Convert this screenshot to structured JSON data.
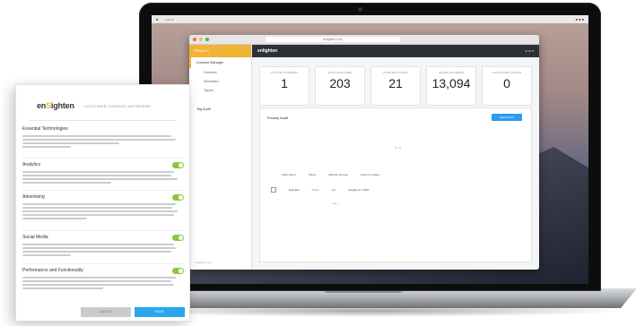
{
  "consent_dialog": {
    "logo_prefix": "en",
    "logo_accent": "S",
    "logo_suffix": "ighten",
    "tagline": "CUSTOMER CONSENT ANYWHERE",
    "sections": [
      {
        "title": "Essential Technologies",
        "toggle": false
      },
      {
        "title": "Analytics",
        "toggle": true
      },
      {
        "title": "Advertising",
        "toggle": true
      },
      {
        "title": "Social Media",
        "toggle": true
      },
      {
        "title": "Performance and Functionality",
        "toggle": true
      }
    ],
    "cancel_label": "CANCEL",
    "save_label": "SAVE",
    "colors": {
      "toggle_on": "#8cc63f",
      "save": "#2aa7ee",
      "brand_accent": "#f1b334"
    }
  },
  "laptop": {
    "url": "enlighten.com",
    "app_title": "enlighten",
    "sidebar": {
      "header": "PRIVACY",
      "items": [
        {
          "label": "Consent Manager"
        },
        {
          "label": "Overview",
          "sub": true
        },
        {
          "label": "Scheduled",
          "sub": true
        },
        {
          "label": "Tag list",
          "sub": true
        },
        {
          "label": "Tag Audit"
        }
      ],
      "footer": "enlighten.com"
    },
    "stat_cards": [
      {
        "label": "VISITOR CONSENT",
        "value": "1"
      },
      {
        "label": "DATA ANALYZED",
        "value": "203"
      },
      {
        "label": "COOKIES FOUND",
        "value": "21"
      },
      {
        "label": "PAGES SCANNED",
        "value": "13,094"
      },
      {
        "label": "VIOLATIONS FOUND",
        "value": "0"
      }
    ],
    "panel": {
      "title": "Privacy Audit",
      "button_label": "NEW AUDIT",
      "columns": [
        "Audit Name",
        "Status",
        "Website Domain",
        "Date & Created"
      ],
      "row": {
        "name": "Example",
        "status": "Active",
        "domain": "enl",
        "date": "January 27, 2019"
      }
    }
  }
}
